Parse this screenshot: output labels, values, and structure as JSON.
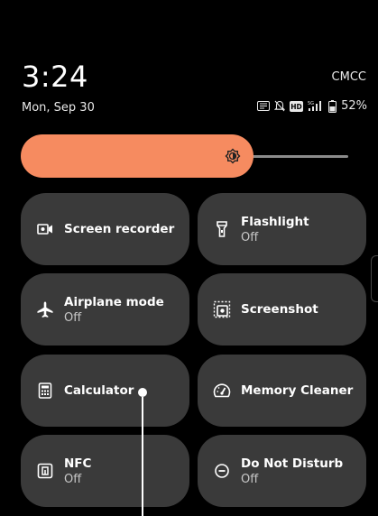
{
  "status": {
    "time": "3:24",
    "carrier": "CMCC",
    "date": "Mon, Sep 30",
    "battery": "52%",
    "icons": [
      "nfc-icon",
      "alarm-off-icon",
      "hd-icon",
      "signal-icon",
      "battery-icon"
    ],
    "hd_label": "HD"
  },
  "brightness": {
    "level": 0.71,
    "fill_color": "#f68b60"
  },
  "tiles": [
    {
      "label": "Screen recorder",
      "sub": "",
      "icon": "screen-recorder-icon"
    },
    {
      "label": "Flashlight",
      "sub": "Off",
      "icon": "flashlight-icon"
    },
    {
      "label": "Airplane mode",
      "sub": "Off",
      "icon": "airplane-icon"
    },
    {
      "label": "Screenshot",
      "sub": "",
      "icon": "screenshot-icon"
    },
    {
      "label": "Calculator",
      "sub": "",
      "icon": "calculator-icon"
    },
    {
      "label": "Memory Cleaner",
      "sub": "",
      "icon": "memory-cleaner-icon"
    },
    {
      "label": "NFC",
      "sub": "Off",
      "icon": "nfc-icon"
    },
    {
      "label": "Do Not Disturb",
      "sub": "Off",
      "icon": "do-not-disturb-icon"
    }
  ],
  "colors": {
    "tile_bg": "#3a3a3a",
    "background": "#000000",
    "accent": "#f68b60"
  }
}
